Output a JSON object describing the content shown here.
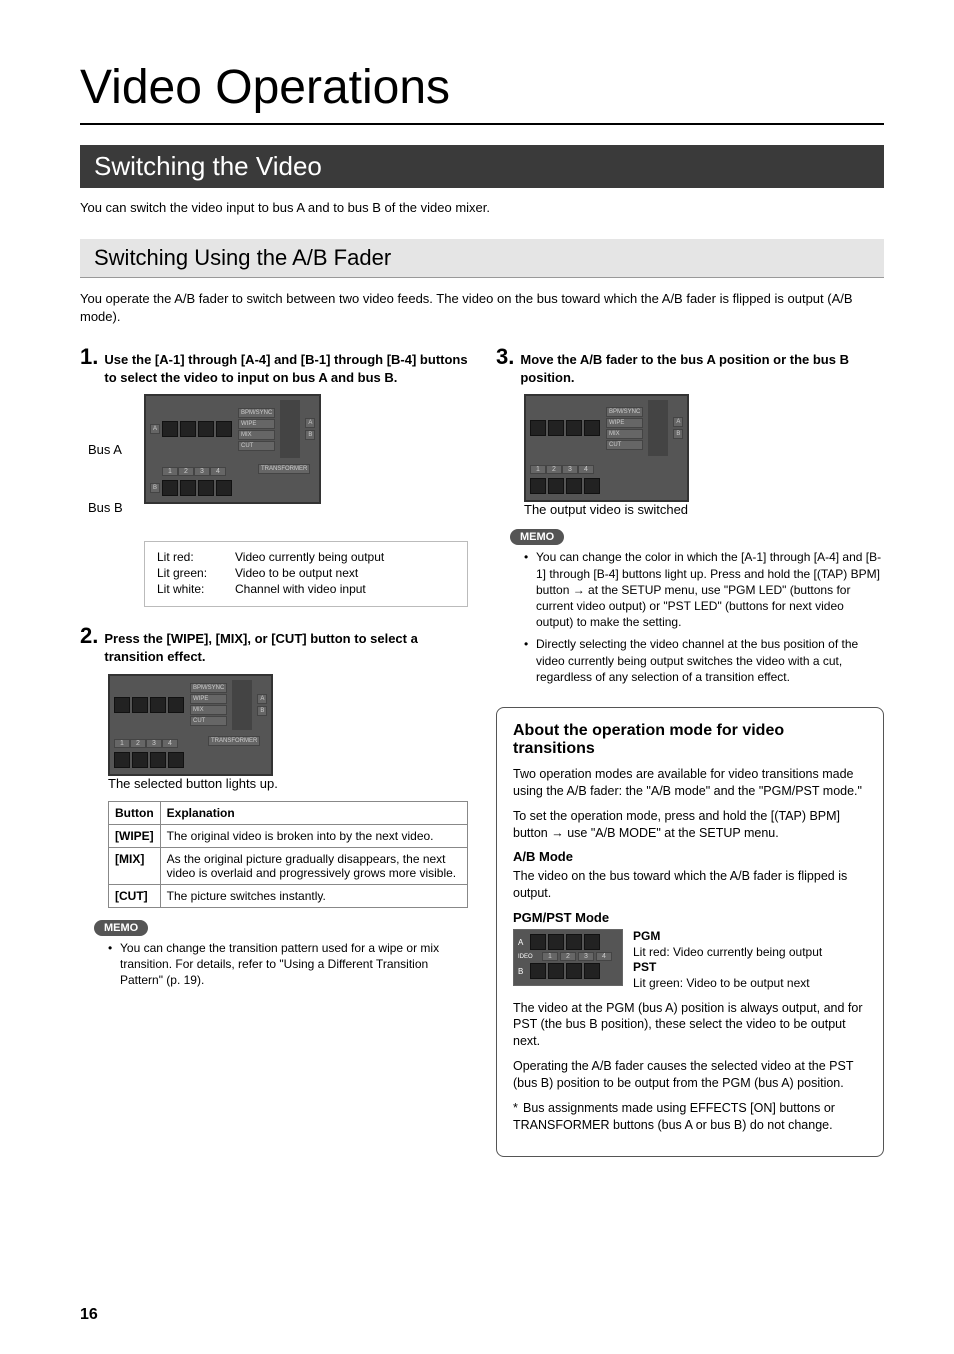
{
  "page": {
    "title": "Video Operations",
    "section": "Switching the Video",
    "section_intro": "You can switch the video input to bus A and to bus B of the video mixer.",
    "subsection": "Switching Using the A/B Fader",
    "subsection_intro": "You operate the A/B fader to switch between two video feeds. The video on the bus toward which the A/B fader is flipped is output (A/B mode).",
    "page_number": "16"
  },
  "steps": {
    "s1_num": "1.",
    "s1_text": "Use the [A-1] through [A-4] and [B-1] through [B-4] buttons to select the video to input on bus A and bus B.",
    "s2_num": "2.",
    "s2_text": "Press the [WIPE], [MIX], or [CUT] button to select a transition effect.",
    "s2_caption": "The selected button lights up.",
    "s3_num": "3.",
    "s3_text": "Move the A/B fader to the bus A position or the bus B position.",
    "s3_caption": "The output video is switched"
  },
  "bus": {
    "A": "Bus A",
    "B": "Bus B"
  },
  "lit": {
    "red_k": "Lit red:",
    "red_v": "Video currently being output",
    "green_k": "Lit green:",
    "green_v": "Video to be output next",
    "white_k": "Lit white:",
    "white_v": "Channel with video input"
  },
  "trans_table": {
    "h1": "Button",
    "h2": "Explanation",
    "rows": [
      {
        "b": "[WIPE]",
        "e": "The original video is broken into by the next video."
      },
      {
        "b": "[MIX]",
        "e": "As the original picture gradually disappears, the next video is overlaid and progressively grows more visible."
      },
      {
        "b": "[CUT]",
        "e": "The picture switches instantly."
      }
    ]
  },
  "memo_label": "MEMO",
  "memo_left": [
    "You can change the transition pattern used for a wipe or mix transition. For details, refer to \"Using a Different Transition Pattern\" (p. 19)."
  ],
  "memo_right": [
    "You can change the color in which the [A-1] through [A-4] and [B-1] through [B-4] buttons light up. Press and hold the [(TAP) BPM] button → at the SETUP menu, use \"PGM LED\" (buttons for current video output) or \"PST LED\" (buttons for next video output) to make the setting.",
    "Directly selecting the video channel at the bus position of the video currently being output switches the video with a cut, regardless of any selection of a transition effect."
  ],
  "info": {
    "title": "About the operation mode for video transitions",
    "p1": "Two operation modes are available for video transitions made using the A/B fader: the \"A/B mode\" and the \"PGM/PST mode.\"",
    "p2": "To set the operation mode, press and hold the [(TAP) BPM] button → use \"A/B MODE\" at the SETUP menu.",
    "ab_h": "A/B Mode",
    "ab_p": "The video on the bus toward which the A/B fader is flipped is output.",
    "pp_h": "PGM/PST Mode",
    "pgm_b": "PGM",
    "pgm_t": "Lit red: Video currently being output",
    "pst_b": "PST",
    "pst_t": "Lit green: Video to be output next",
    "pp_p1": "The video at the PGM (bus A) position is always output, and for PST (the bus B position), these select the video to be output next.",
    "pp_p2": "Operating the A/B fader causes the selected video at the PST (bus B) position to be output from the PGM (bus A) position.",
    "fn": "Bus assignments made using EFFECTS [ON] buttons or TRANSFORMER buttons (bus A or bus B) do not change."
  },
  "panel_labels": {
    "bpm": "BPM/SYNC",
    "wipe": "WIPE",
    "mix": "MIX",
    "cut": "CUT",
    "transformer": "TRANSFORMER",
    "nums": [
      "1",
      "2",
      "3",
      "4"
    ],
    "A": "A",
    "B": "B",
    "ideo": "IDEO"
  }
}
